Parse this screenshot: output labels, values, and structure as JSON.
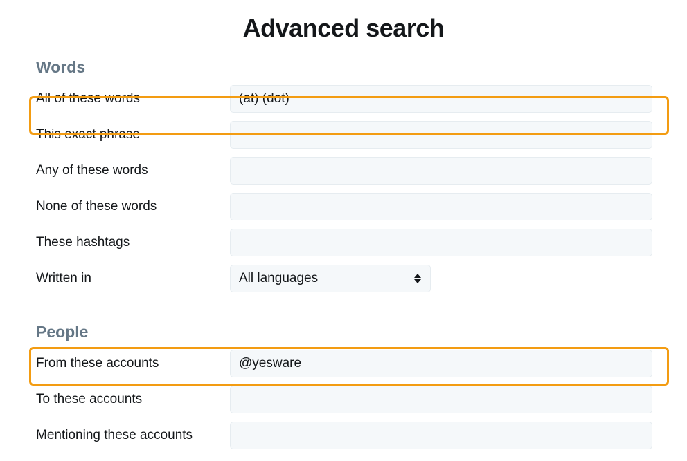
{
  "title": "Advanced search",
  "sections": {
    "words": {
      "heading": "Words",
      "all_of_these_words": {
        "label": "All of these words",
        "value": "(at) (dot)"
      },
      "exact_phrase": {
        "label": "This exact phrase",
        "value": ""
      },
      "any_of_these_words": {
        "label": "Any of these words",
        "value": ""
      },
      "none_of_these_words": {
        "label": "None of these words",
        "value": ""
      },
      "these_hashtags": {
        "label": "These hashtags",
        "value": ""
      },
      "written_in": {
        "label": "Written in",
        "value": "All languages"
      }
    },
    "people": {
      "heading": "People",
      "from_accounts": {
        "label": "From these accounts",
        "value": "@yesware"
      },
      "to_accounts": {
        "label": "To these accounts",
        "value": ""
      },
      "mentioning_accounts": {
        "label": "Mentioning these accounts",
        "value": ""
      }
    }
  },
  "annotations": {
    "highlight_color": "#F39C12"
  }
}
